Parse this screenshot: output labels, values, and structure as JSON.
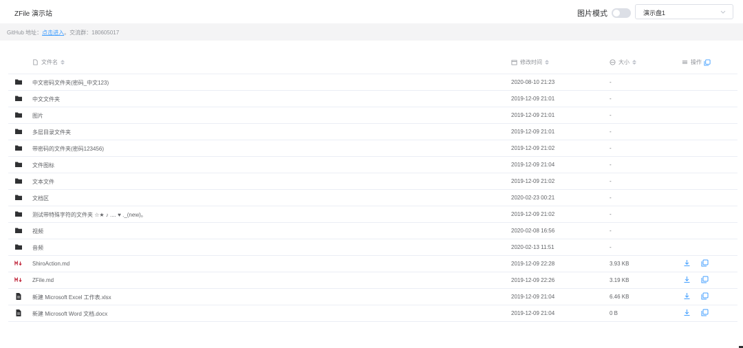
{
  "header": {
    "title": "ZFile 演示站",
    "mode_label": "图片模式",
    "mode_on": false,
    "drive_select": "演示盘1"
  },
  "infobar": {
    "github_prefix": "GitHub 地址：",
    "github_link": "点击进入",
    "separator": "。",
    "group_text": "交流群：180605017"
  },
  "table": {
    "columns": {
      "name": "文件名",
      "time": "修改时间",
      "size": "大小",
      "action": "操作"
    },
    "rows": [
      {
        "type": "folder",
        "name": "中文密码文件夹(密码_中文123)",
        "time": "2020-08-10 21:23",
        "size": "-"
      },
      {
        "type": "folder",
        "name": "中文文件夹",
        "time": "2019-12-09 21:01",
        "size": "-"
      },
      {
        "type": "folder",
        "name": "图片",
        "time": "2019-12-09 21:01",
        "size": "-"
      },
      {
        "type": "folder",
        "name": "多层目录文件夹",
        "time": "2019-12-09 21:01",
        "size": "-"
      },
      {
        "type": "folder",
        "name": "带密码的文件夹(密码123456)",
        "time": "2019-12-09 21:02",
        "size": "-"
      },
      {
        "type": "folder",
        "name": "文件图标",
        "time": "2019-12-09 21:04",
        "size": "-"
      },
      {
        "type": "folder",
        "name": "文本文件",
        "time": "2019-12-09 21:02",
        "size": "-"
      },
      {
        "type": "folder",
        "name": "文档区",
        "time": "2020-02-23 00:21",
        "size": "-"
      },
      {
        "type": "folder",
        "name": "测试带特殊字符的文件夹 ☆★ ♪ .... ♥ ._(new)。",
        "time": "2019-12-09 21:02",
        "size": "-"
      },
      {
        "type": "folder",
        "name": "视频",
        "time": "2020-02-08 16:56",
        "size": "-"
      },
      {
        "type": "folder",
        "name": "音频",
        "time": "2020-02-13 11:51",
        "size": "-"
      },
      {
        "type": "markdown",
        "name": "ShiroAction.md",
        "time": "2019-12-09 22:28",
        "size": "3.93 KB"
      },
      {
        "type": "markdown",
        "name": "ZFile.md",
        "time": "2019-12-09 22:26",
        "size": "3.19 KB"
      },
      {
        "type": "file",
        "name": "新建 Microsoft Excel 工作表.xlsx",
        "time": "2019-12-09 21:04",
        "size": "6.46 KB"
      },
      {
        "type": "file",
        "name": "新建 Microsoft Word 文档.docx",
        "time": "2019-12-09 21:04",
        "size": "0 B"
      }
    ]
  },
  "icons": {
    "folder": "folder-icon",
    "markdown": "markdown-icon",
    "file": "document-icon",
    "download": "download-icon",
    "copy": "copy-icon"
  },
  "colors": {
    "accent": "#409eff",
    "markdown": "#c0253a",
    "folder": "#303133"
  }
}
